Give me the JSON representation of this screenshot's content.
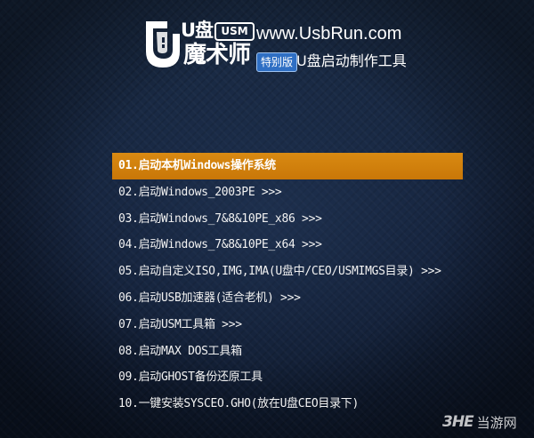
{
  "header": {
    "brand_u": "U盘",
    "usm_badge": "USM",
    "brand_name": "魔术师",
    "site_url": "www.UsbRun.com",
    "special_badge": "特别版",
    "subtitle": "U盘启动制作工具"
  },
  "menu": {
    "selected_index": 0,
    "items": [
      {
        "label": "01.启动本机Windows操作系统"
      },
      {
        "label": "02.启动Windows_2003PE >>>"
      },
      {
        "label": "03.启动Windows_7&8&10PE_x86 >>>"
      },
      {
        "label": "04.启动Windows_7&8&10PE_x64 >>>"
      },
      {
        "label": "05.启动自定义ISO,IMG,IMA(U盘中/CEO/USMIMGS目录) >>>"
      },
      {
        "label": "06.启动USB加速器(适合老机) >>>"
      },
      {
        "label": "07.启动USM工具箱 >>>"
      },
      {
        "label": "08.启动MAX DOS工具箱"
      },
      {
        "label": "09.启动GHOST备份还原工具"
      },
      {
        "label": "10.一键安装SYSCEO.GHO(放在U盘CEO目录下)"
      }
    ]
  },
  "watermark": {
    "logo": "3HE",
    "text": "当游网"
  },
  "colors": {
    "background": "#16233a",
    "highlight": "#d98a12",
    "menu_text": "#f2f2f2",
    "badge_blue": "#2f6fc4"
  },
  "icons": {
    "logo": "usm-shield-logo-icon"
  }
}
